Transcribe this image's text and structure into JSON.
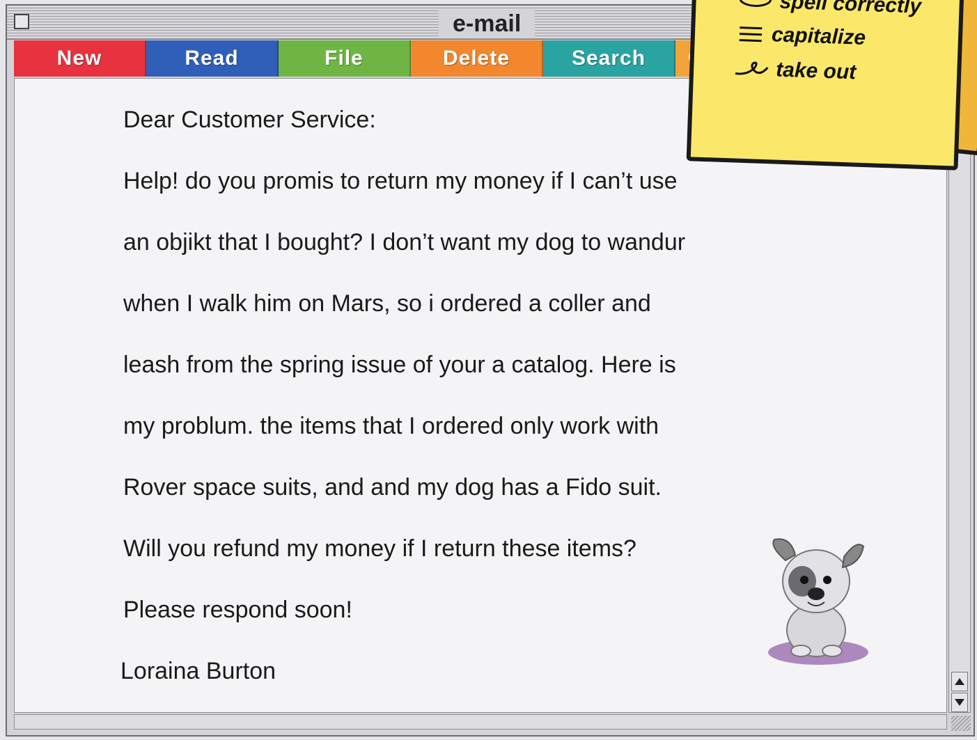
{
  "window": {
    "title": "e-mail"
  },
  "toolbar": {
    "buttons": [
      {
        "label": "New",
        "color": "#e8323f"
      },
      {
        "label": "Read",
        "color": "#2f5fb8"
      },
      {
        "label": "File",
        "color": "#6fb544"
      },
      {
        "label": "Delete",
        "color": "#f2872e"
      },
      {
        "label": "Search",
        "color": "#2aa3a3"
      },
      {
        "label": "C",
        "color": "#f2a33a"
      }
    ]
  },
  "sticky_note": {
    "items": [
      {
        "icon": "circle-mark-icon",
        "label": "spell correctly"
      },
      {
        "icon": "triple-underline-icon",
        "label": "capitalize"
      },
      {
        "icon": "delete-loop-icon",
        "label": "take out"
      }
    ]
  },
  "letter": {
    "lines": [
      "Dear Customer Service:",
      "Help! do you promis to return my money if I can’t use",
      "an objikt that I bought? I don’t want my dog to wandur",
      "when I walk him on Mars, so i ordered a coller and",
      "leash from the spring issue of your a catalog. Here is",
      "my problum. the items that I ordered only work with",
      "Rover space suits, and and my dog has a Fido suit.",
      "Will you refund my money if I return these items?",
      "Please respond soon!",
      "Loraina Burton"
    ]
  }
}
